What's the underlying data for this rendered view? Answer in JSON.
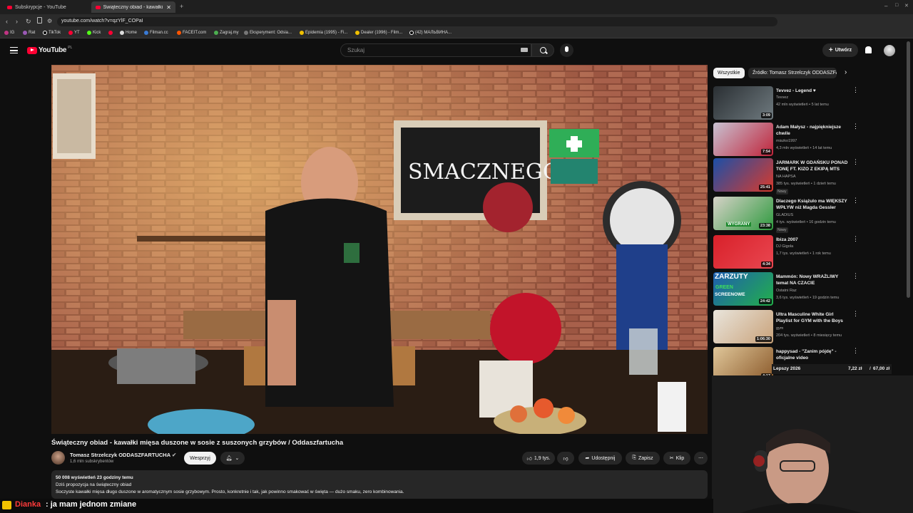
{
  "browser": {
    "tabs": [
      {
        "label": "Subskrypcje - YouTube"
      },
      {
        "label": "Świąteczny obiad - kawałki m"
      }
    ],
    "url": "youtube.com/watch?v=qzYlF_COPaI",
    "bookmarks": [
      "IG",
      "Rat",
      "TikTok",
      "YT",
      "Kick",
      "Home",
      "Filman.cc",
      "FACEIT.com",
      "Zagraj.my",
      "Eksperyment: Odsia...",
      "Epidemia (1995) - Fi...",
      "Dealer (1996) - Film...",
      "(42) МАЛЬВИНА..."
    ]
  },
  "header": {
    "logo_text": "YouTube",
    "region": "PL",
    "search_placeholder": "Szukaj",
    "create_label": "Utwórz"
  },
  "video": {
    "title": "Świąteczny obiad - kawałki mięsa duszone w sosie z suszonych grzybów / Oddaszfartucha",
    "channel": "Tomasz Strzelczyk ODDASZFARTUCHA",
    "subscribers": "1,6 mln subskrybentów",
    "support_label": "Wesprzyj",
    "likes": "1,9 tys.",
    "share_label": "Udostępnij",
    "save_label": "Zapisz",
    "clip_label": "Klip",
    "chalkboard_text": "SMACZNEGO",
    "description": {
      "meta": "50 008 wyświetleń  23 godziny temu",
      "line1": "Dziś propozycja na świąteczny obiad",
      "line2": "Soczyste kawałki mięsa długo duszone w aromatycznym sosie grzybowym. Prosto, konkretnie i tak, jak powinno smakować w święta — dużo smaku, zero kombinowania."
    }
  },
  "sidebar": {
    "chips": [
      "Wszystkie",
      "Źródło: Tomasz Strzelczyk ODDASZFA"
    ],
    "recommendations": [
      {
        "title": "Tevvez - Legend ♥",
        "channel": "Tevvez",
        "views": "42 mln wyświetleń • 5 lat temu",
        "duration": "3:09",
        "new": "",
        "colors": [
          "#2a2f33",
          "#6f7a7f"
        ]
      },
      {
        "title": "Adam Małysz - najpiękniejsze chwile",
        "channel": "miszko1997",
        "views": "4,3 mln wyświetleń • 14 lat temu",
        "duration": "7:54",
        "new": "",
        "colors": [
          "#c8c2d2",
          "#c0243a"
        ]
      },
      {
        "title": "JARMARK W GDAŃSKU PONAD TONĘ FT. KIZO Z EKIPĄ MTS",
        "channel": "NA HAPSA",
        "views": "385 tys. wyświetleń • 1 dzień temu",
        "duration": "25:41",
        "new": "Nowy",
        "colors": [
          "#1b4fa8",
          "#d83a2c"
        ]
      },
      {
        "title": "Dlaczego Książulo ma WIĘKSZY WPŁYW niż Magda Gessler",
        "channel": "GLADIUS",
        "views": "4 tys. wyświetleń • 16 godzin temu",
        "duration": "23:38",
        "new": "Nowy",
        "colors": [
          "#d7d2c8",
          "#2e9a3e"
        ]
      },
      {
        "title": "Ibiza 2007",
        "channel": "DJ Gigola",
        "views": "1,7 tys. wyświetleń • 1 rok temu",
        "duration": "4:34",
        "new": "",
        "colors": [
          "#d8212a",
          "#e94650"
        ]
      },
      {
        "title": "Mammón: Nowy WRAŻLIWY temat NA CZACIE",
        "channel": "Ostatni Raz",
        "views": "3,6 tys. wyświetleń • 19 godzin temu",
        "duration": "24:42",
        "new": "",
        "colors": [
          "#1e5db1",
          "#22b04a"
        ]
      },
      {
        "title": "Ultra Masculine White Girl Playlist for GYM with the Boys",
        "channel": "gym",
        "views": "204 tys. wyświetleń • 8 miesięcy temu",
        "duration": "1:06:30",
        "new": "",
        "colors": [
          "#e9e5dc",
          "#c9a27a"
        ]
      },
      {
        "title": "happysad - \"Zanim pójdę\" - oficjalne video",
        "channel": "",
        "views": "",
        "duration": "4:17",
        "new": "",
        "colors": [
          "#e0c79a",
          "#8b5a2b"
        ]
      }
    ],
    "thumb_texts": {
      "zarzuty": "ZARZUTY",
      "green": "GREEN",
      "screen": "SCREENOWE",
      "wygrany": "WYGRANY"
    }
  },
  "overlay": {
    "goal_label": "Lepszy 2026",
    "goal_amount": "7,22 zł",
    "goal_target": "67,00 zł"
  },
  "chat": {
    "user": "Dianka",
    "message": ": ja mam jednom zmiane"
  }
}
